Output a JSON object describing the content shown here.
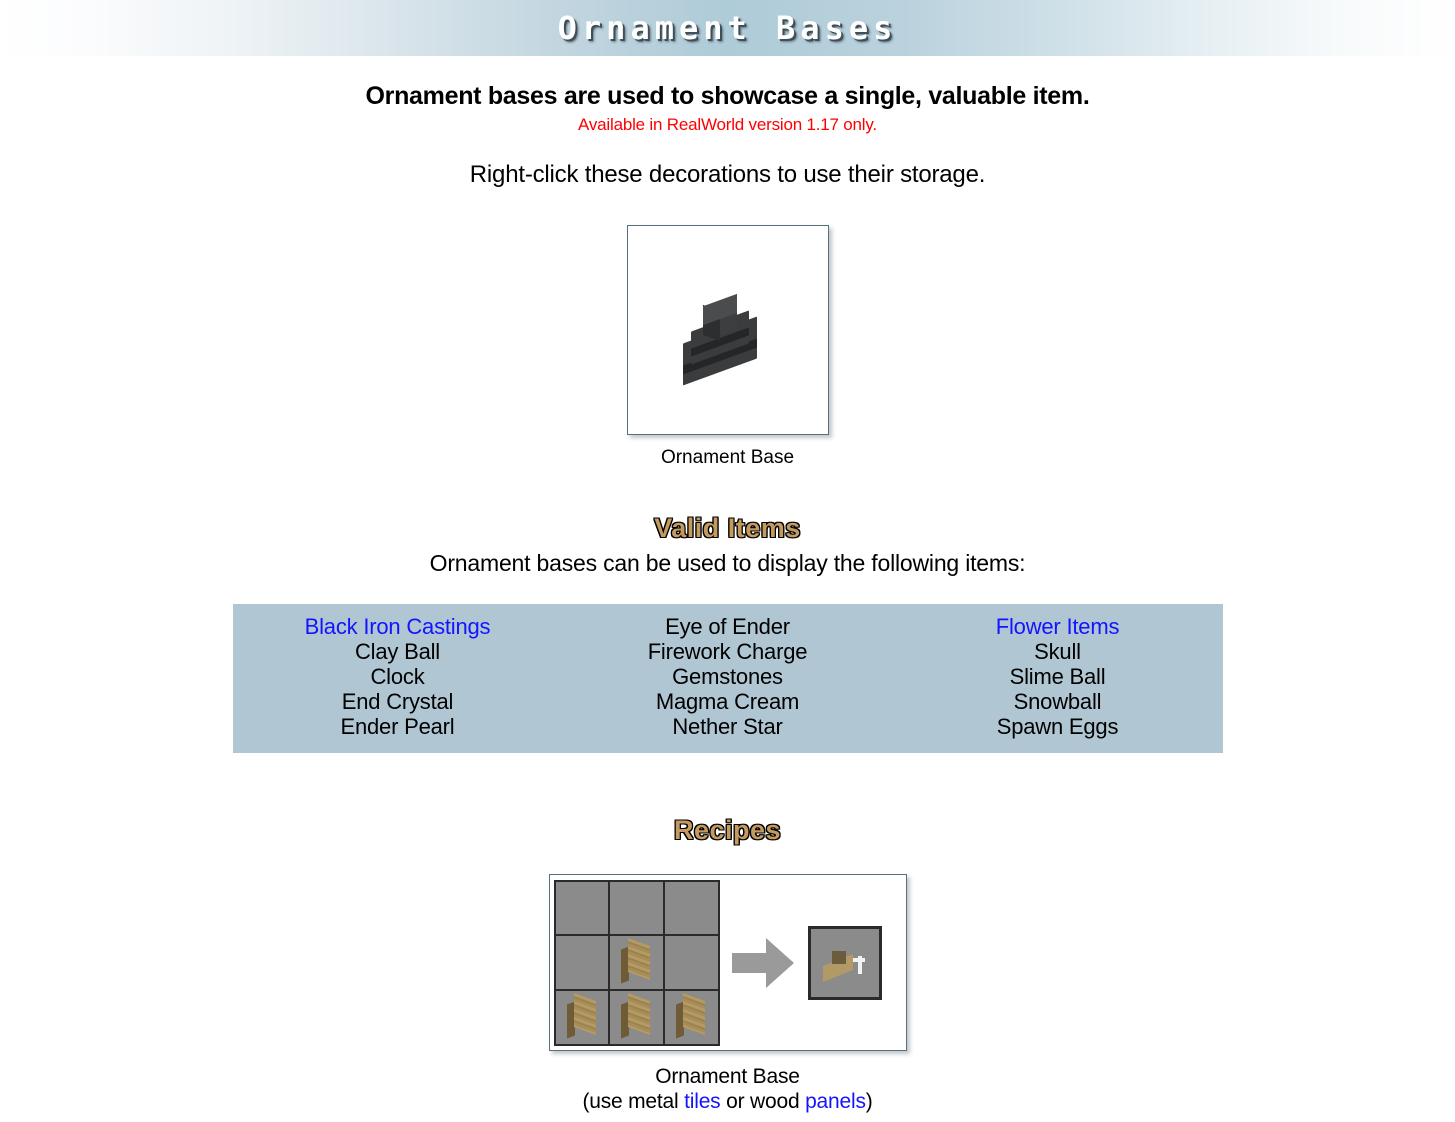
{
  "header": {
    "title": "Ornament Bases"
  },
  "intro": {
    "lead": "Ornament bases are used to showcase a single, valuable item.",
    "version_note": "Available in RealWorld version 1.17 only.",
    "hint": "Right-click these decorations to use their storage."
  },
  "showcase": {
    "caption": "Ornament Base",
    "icon": "ornament-base-pedestal-icon"
  },
  "valid_items": {
    "heading": "Valid Items",
    "subtitle": "Ornament bases can be used to display the following items:",
    "columns": [
      [
        {
          "label": "Black Iron Castings",
          "is_link": true
        },
        {
          "label": "Clay Ball",
          "is_link": false
        },
        {
          "label": "Clock",
          "is_link": false
        },
        {
          "label": "End Crystal",
          "is_link": false
        },
        {
          "label": "Ender Pearl",
          "is_link": false
        }
      ],
      [
        {
          "label": "Eye of Ender",
          "is_link": false
        },
        {
          "label": "Firework Charge",
          "is_link": false
        },
        {
          "label": "Gemstones",
          "is_link": false
        },
        {
          "label": "Magma Cream",
          "is_link": false
        },
        {
          "label": "Nether Star",
          "is_link": false
        }
      ],
      [
        {
          "label": "Flower Items",
          "is_link": true
        },
        {
          "label": "Skull",
          "is_link": false
        },
        {
          "label": "Slime Ball",
          "is_link": false
        },
        {
          "label": "Snowball",
          "is_link": false
        },
        {
          "label": "Spawn Eggs",
          "is_link": false
        }
      ]
    ]
  },
  "recipes": {
    "heading": "Recipes",
    "grid": [
      [
        "",
        "",
        ""
      ],
      [
        "",
        "wood-panel",
        ""
      ],
      [
        "wood-panel",
        "wood-panel",
        "wood-panel"
      ]
    ],
    "arrow_icon": "arrow-right-icon",
    "output": "ornament-base-small-icon",
    "caption_title": "Ornament Base",
    "caption_prefix": "(use metal ",
    "caption_link_1": "tiles",
    "caption_middle": " or wood ",
    "caption_link_2": "panels",
    "caption_suffix": ")"
  },
  "colors": {
    "banner_accent": "#aecbd8",
    "panel_bg": "#b0c7d3",
    "link": "#1414ff",
    "warning": "#ff0000",
    "heading_bronze": "#c49a5e"
  }
}
